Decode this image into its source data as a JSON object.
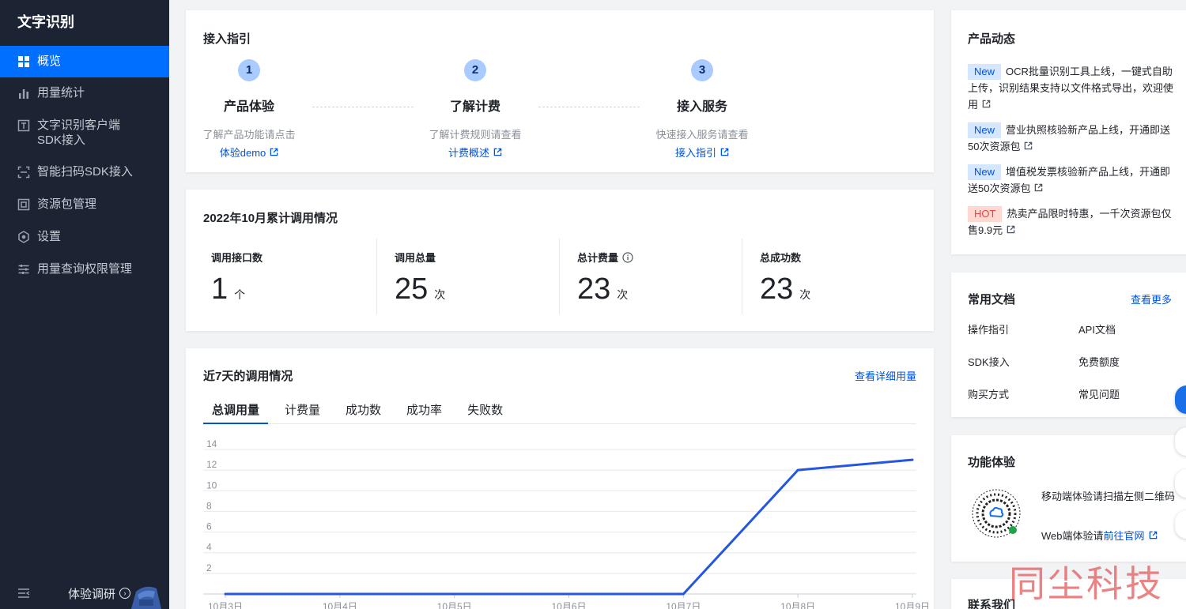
{
  "sidebar": {
    "title": "文字识别",
    "items": [
      {
        "label": "概览"
      },
      {
        "label": "用量统计"
      },
      {
        "label": "文字识别客户端",
        "label2": "SDK接入"
      },
      {
        "label": "智能扫码SDK接入"
      },
      {
        "label": "资源包管理"
      },
      {
        "label": "设置"
      },
      {
        "label": "用量查询权限管理"
      }
    ],
    "footer_label": "体验调研",
    "footer_arrow": "›"
  },
  "guide": {
    "title": "接入指引",
    "steps": [
      {
        "num": "1",
        "name": "产品体验",
        "desc": "了解产品功能请点击",
        "link": "体验demo"
      },
      {
        "num": "2",
        "name": "了解计费",
        "desc": "了解计费规则请查看",
        "link": "计费概述"
      },
      {
        "num": "3",
        "name": "接入服务",
        "desc": "快速接入服务请查看",
        "link": "接入指引"
      }
    ]
  },
  "stats": {
    "title": "2022年10月累计调用情况",
    "items": [
      {
        "label": "调用接口数",
        "value": "1",
        "unit": "个"
      },
      {
        "label": "调用总量",
        "value": "25",
        "unit": "次"
      },
      {
        "label": "总计费量",
        "value": "23",
        "unit": "次"
      },
      {
        "label": "总成功数",
        "value": "23",
        "unit": "次"
      }
    ]
  },
  "usage": {
    "title": "近7天的调用情况",
    "detail_link": "查看详细用量",
    "tabs": [
      "总调用量",
      "计费量",
      "成功数",
      "成功率",
      "失败数"
    ]
  },
  "chart_data": {
    "type": "line",
    "x": [
      "10月3日",
      "10月4日",
      "10月5日",
      "10月6日",
      "10月7日",
      "10月8日",
      "10月9日"
    ],
    "series": [
      {
        "values": [
          0,
          0,
          0,
          0,
          0,
          12,
          13
        ]
      }
    ],
    "y_ticks": [
      2,
      4,
      6,
      8,
      10,
      12,
      14
    ],
    "ylim": [
      0,
      14
    ],
    "grid": true,
    "line_color": "#2456e0"
  },
  "news": {
    "title": "产品动态",
    "items": [
      {
        "badge": "New",
        "text": "OCR批量识别工具上线，一键式自助上传，识别结果支持以文件格式导出，欢迎使用"
      },
      {
        "badge": "New",
        "text": "营业执照核验新产品上线，开通即送50次资源包"
      },
      {
        "badge": "New",
        "text": "增值税发票核验新产品上线，开通即送50次资源包"
      },
      {
        "badge": "HOT",
        "text": "热卖产品限时特惠，一千次资源包仅售9.9元"
      }
    ]
  },
  "docs": {
    "title": "常用文档",
    "more": "查看更多",
    "items": [
      "操作指引",
      "API文档",
      "SDK接入",
      "免费额度",
      "购买方式",
      "常见问题"
    ]
  },
  "feature": {
    "title": "功能体验",
    "mobile_text": "移动端体验请扫描左侧二维码",
    "web_prefix": "Web端体验请",
    "web_link": "前往官网"
  },
  "contact": {
    "title": "联系我们"
  },
  "watermark": "同尘科技",
  "colors": {
    "accent": "#006eff",
    "link": "#0052d9",
    "sidebar_bg": "#1c2333"
  }
}
